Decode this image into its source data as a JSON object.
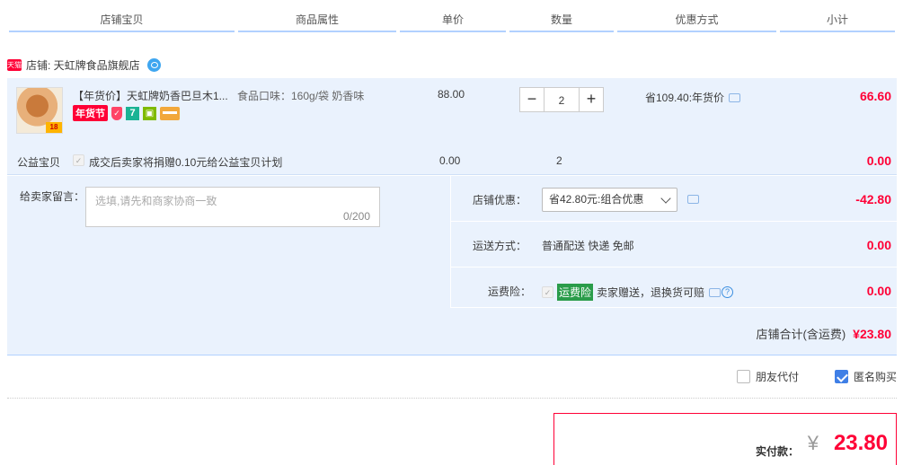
{
  "header": {
    "columns": [
      "店铺宝贝",
      "商品属性",
      "单价",
      "数量",
      "优惠方式",
      "小计"
    ]
  },
  "shop": {
    "badge": "天猫",
    "label": "店铺: 天虹牌食品旗舰店"
  },
  "item": {
    "thumb_badge": "18",
    "title": "【年货价】天虹牌奶香巴旦木1...",
    "tags": {
      "festival": "年货节",
      "seven": "7"
    },
    "property": "食品口味：160g/袋 奶香味",
    "unit_price": "88.00",
    "qty_minus": "−",
    "quantity": "2",
    "qty_plus": "+",
    "discount": "省109.40:年货价",
    "subtotal": "66.60"
  },
  "charity": {
    "label": "公益宝贝",
    "checkmark": "✓",
    "text": "成交后卖家将捐赠0.10元给公益宝贝计划",
    "price": "0.00",
    "quantity": "2",
    "subtotal": "0.00"
  },
  "memo": {
    "label": "给卖家留言：",
    "placeholder": "选填,请先和商家协商一致",
    "count": "0/200"
  },
  "shop_discount": {
    "label": "店铺优惠：",
    "selected": "省42.80元:组合优惠",
    "amount": "-42.80"
  },
  "delivery": {
    "label": "运送方式：",
    "value": "普通配送 快递 免邮",
    "amount": "0.00"
  },
  "insurance": {
    "label": "运费险：",
    "checkmark": "✓",
    "tag": "运费险",
    "text": "卖家赠送，退换货可赔",
    "help": "?",
    "amount": "0.00"
  },
  "shop_total": {
    "label": "店铺合计(含运费)",
    "amount": "¥23.80"
  },
  "options": {
    "friend_pay": "朋友代付",
    "friend_pay_checked": false,
    "anonymous": "匿名购买",
    "anonymous_checked": true
  },
  "payment": {
    "label": "实付款：",
    "currency": "¥",
    "amount": "23.80"
  },
  "colors": {
    "accent": "#ff0036",
    "row_bg": "#eaf2fd",
    "header_line": "#b2d1ff",
    "checkbox": "#3f7fe6"
  }
}
